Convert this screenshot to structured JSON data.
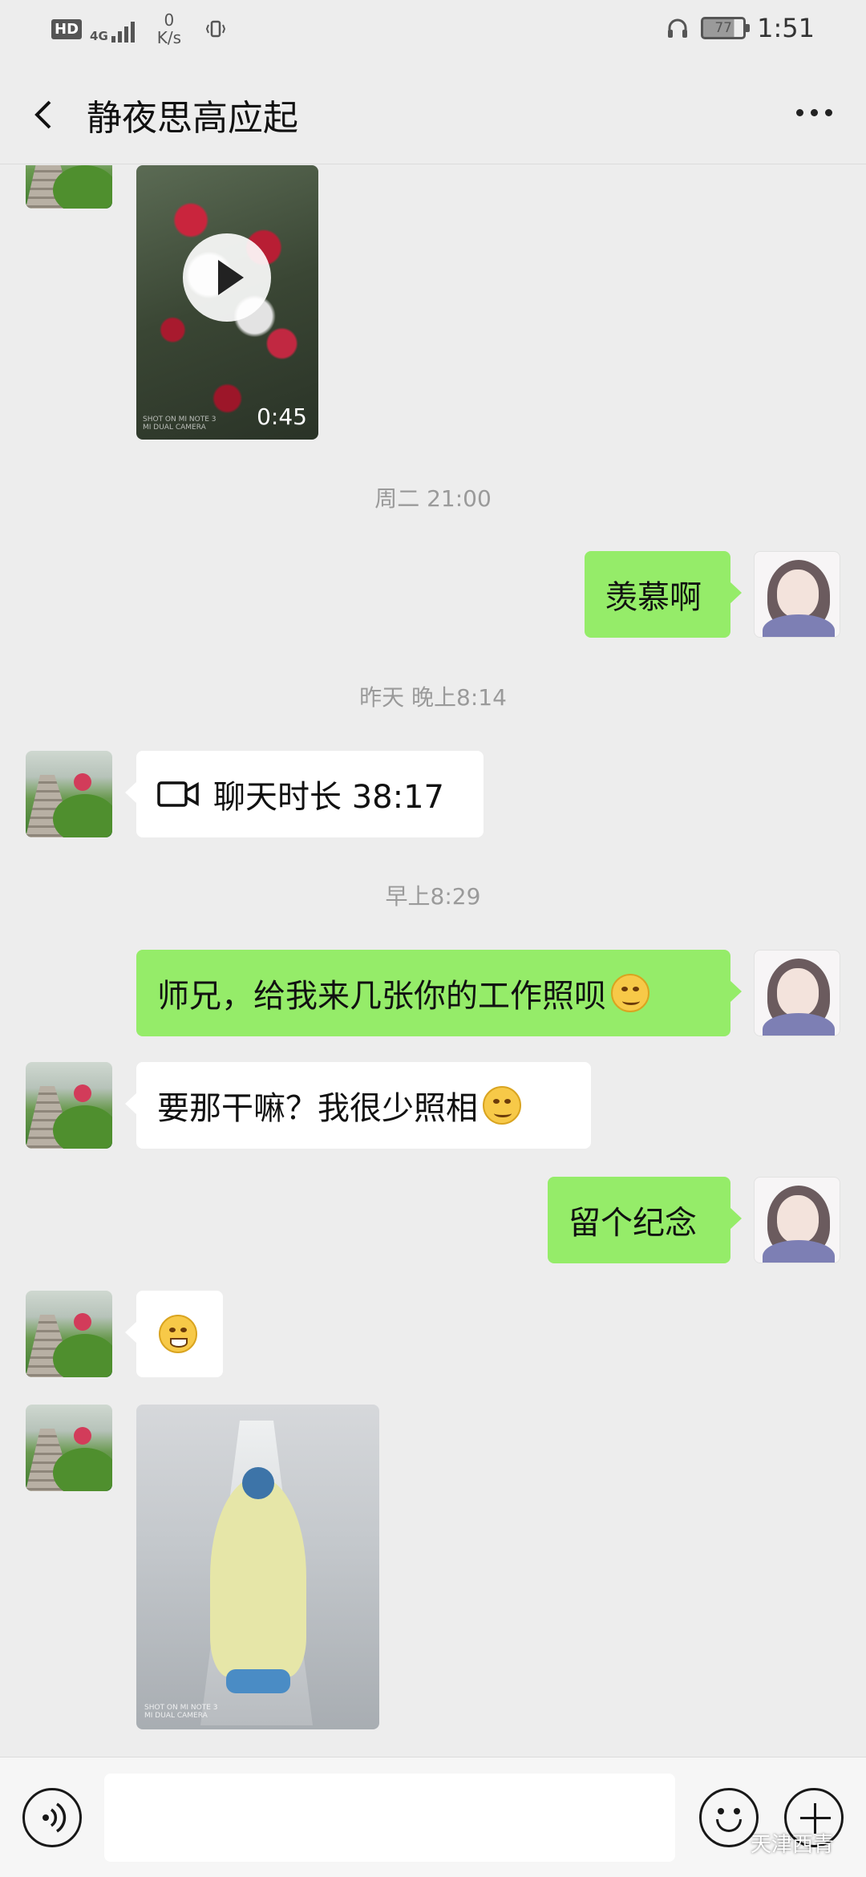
{
  "status_bar": {
    "hd": "HD",
    "network": "4G",
    "speed_value": "0",
    "speed_unit": "K/s",
    "battery": "77",
    "time": "1:51"
  },
  "header": {
    "title": "静夜思高应起"
  },
  "messages": {
    "video_duration": "0:45",
    "video_cam": "SHOT ON MI NOTE 3\nMI DUAL CAMERA",
    "ts1": "周二 21:00",
    "m1": "羡慕啊",
    "ts2": "昨天 晚上8:14",
    "call": "聊天时长 38:17",
    "ts3": "早上8:29",
    "m2": "师兄，给我来几张你的工作照呗",
    "m3": "要那干嘛？我很少照相",
    "m4": "留个纪念",
    "photo_cam": "SHOT ON MI NOTE 3\nMI DUAL CAMERA"
  },
  "input": {
    "watermark": "天津西青"
  },
  "colors": {
    "outgoing_bubble": "#95ec69",
    "incoming_bubble": "#ffffff",
    "background": "#ededed"
  }
}
